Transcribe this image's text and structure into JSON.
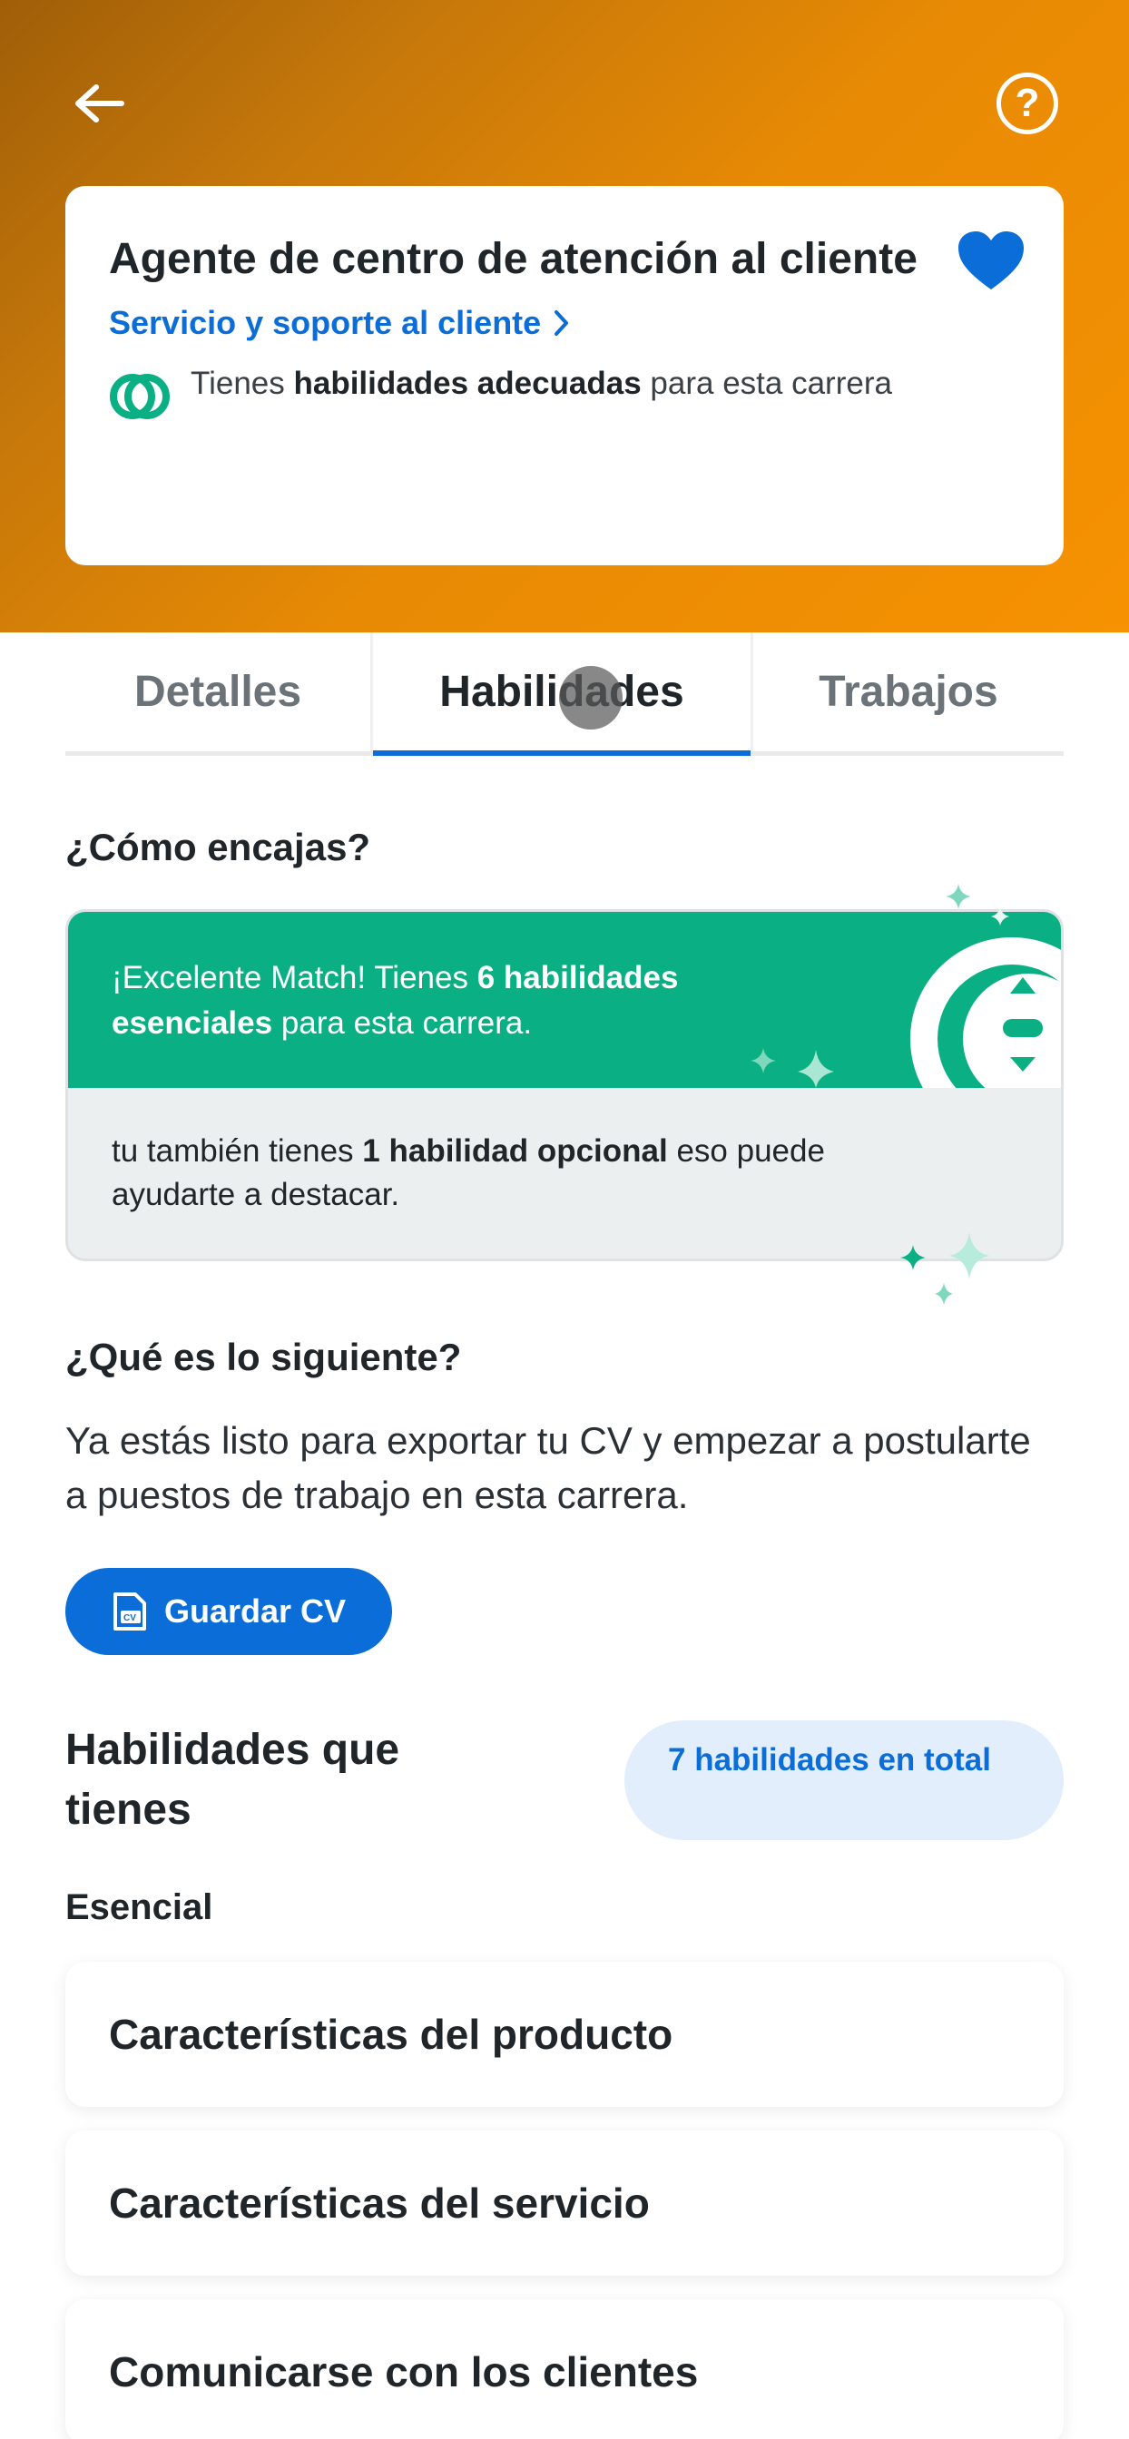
{
  "colors": {
    "header_gradient_start": "#a05e08",
    "header_gradient_end": "#f69202",
    "accent_blue": "#0b6dd8",
    "match_green": "#0ab083"
  },
  "header": {
    "back_icon": "arrow-left-icon",
    "help_icon": "question-circle-icon"
  },
  "career": {
    "title": "Agente de centro de atención al cliente",
    "category": "Servicio y soporte al cliente",
    "favorite_icon": "heart-icon",
    "match_prefix": "Tienes ",
    "match_bold": "habilidades adecuadas",
    "match_suffix": " para esta carrera"
  },
  "tabs": [
    {
      "label": "Detalles"
    },
    {
      "label": "Habilidades",
      "selected": true
    },
    {
      "label": "Trabajos"
    }
  ],
  "fit": {
    "heading": "¿Cómo encajas?",
    "top_prefix": "¡Excelente Match! Tienes ",
    "top_bold": "6 habilidades esenciales",
    "top_suffix": " para esta carrera.",
    "bottom_prefix": "tu también tienes ",
    "bottom_bold": "1 habilidad opcional",
    "bottom_suffix": " eso puede ayudarte a destacar."
  },
  "next": {
    "heading": "¿Qué es lo siguiente?",
    "text": "Ya estás listo para exportar tu CV y empezar a postularte a puestos de trabajo en esta carrera.",
    "button_label": "Guardar CV",
    "button_icon": "cv-document-icon"
  },
  "skills": {
    "title": "Habilidades que tienes",
    "total_badge": "7 habilidades en total",
    "group_label": "Esencial",
    "items": [
      {
        "label": "Características del producto"
      },
      {
        "label": "Características del servicio"
      },
      {
        "label": "Comunicarse con los clientes"
      }
    ]
  }
}
